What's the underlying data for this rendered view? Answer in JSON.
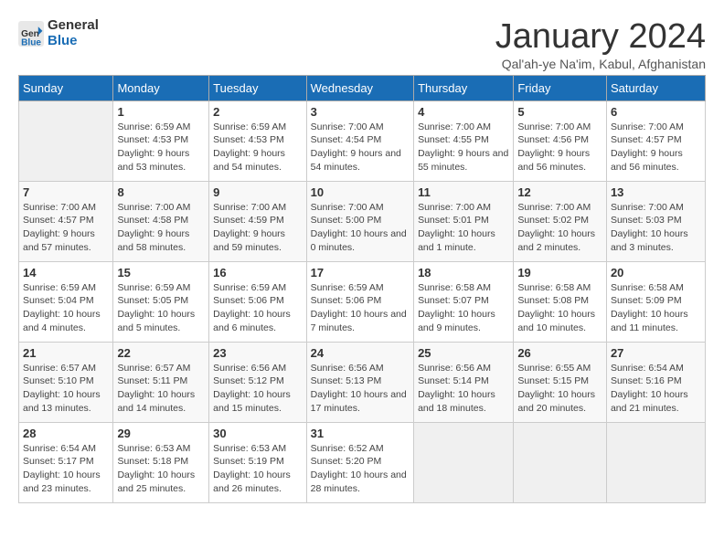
{
  "logo": {
    "line1": "General",
    "line2": "Blue"
  },
  "title": "January 2024",
  "subtitle": "Qal'ah-ye Na'im, Kabul, Afghanistan",
  "days_of_week": [
    "Sunday",
    "Monday",
    "Tuesday",
    "Wednesday",
    "Thursday",
    "Friday",
    "Saturday"
  ],
  "weeks": [
    [
      {
        "day": "",
        "sunrise": "",
        "sunset": "",
        "daylight": ""
      },
      {
        "day": "1",
        "sunrise": "Sunrise: 6:59 AM",
        "sunset": "Sunset: 4:53 PM",
        "daylight": "Daylight: 9 hours and 53 minutes."
      },
      {
        "day": "2",
        "sunrise": "Sunrise: 6:59 AM",
        "sunset": "Sunset: 4:53 PM",
        "daylight": "Daylight: 9 hours and 54 minutes."
      },
      {
        "day": "3",
        "sunrise": "Sunrise: 7:00 AM",
        "sunset": "Sunset: 4:54 PM",
        "daylight": "Daylight: 9 hours and 54 minutes."
      },
      {
        "day": "4",
        "sunrise": "Sunrise: 7:00 AM",
        "sunset": "Sunset: 4:55 PM",
        "daylight": "Daylight: 9 hours and 55 minutes."
      },
      {
        "day": "5",
        "sunrise": "Sunrise: 7:00 AM",
        "sunset": "Sunset: 4:56 PM",
        "daylight": "Daylight: 9 hours and 56 minutes."
      },
      {
        "day": "6",
        "sunrise": "Sunrise: 7:00 AM",
        "sunset": "Sunset: 4:57 PM",
        "daylight": "Daylight: 9 hours and 56 minutes."
      }
    ],
    [
      {
        "day": "7",
        "sunrise": "Sunrise: 7:00 AM",
        "sunset": "Sunset: 4:57 PM",
        "daylight": "Daylight: 9 hours and 57 minutes."
      },
      {
        "day": "8",
        "sunrise": "Sunrise: 7:00 AM",
        "sunset": "Sunset: 4:58 PM",
        "daylight": "Daylight: 9 hours and 58 minutes."
      },
      {
        "day": "9",
        "sunrise": "Sunrise: 7:00 AM",
        "sunset": "Sunset: 4:59 PM",
        "daylight": "Daylight: 9 hours and 59 minutes."
      },
      {
        "day": "10",
        "sunrise": "Sunrise: 7:00 AM",
        "sunset": "Sunset: 5:00 PM",
        "daylight": "Daylight: 10 hours and 0 minutes."
      },
      {
        "day": "11",
        "sunrise": "Sunrise: 7:00 AM",
        "sunset": "Sunset: 5:01 PM",
        "daylight": "Daylight: 10 hours and 1 minute."
      },
      {
        "day": "12",
        "sunrise": "Sunrise: 7:00 AM",
        "sunset": "Sunset: 5:02 PM",
        "daylight": "Daylight: 10 hours and 2 minutes."
      },
      {
        "day": "13",
        "sunrise": "Sunrise: 7:00 AM",
        "sunset": "Sunset: 5:03 PM",
        "daylight": "Daylight: 10 hours and 3 minutes."
      }
    ],
    [
      {
        "day": "14",
        "sunrise": "Sunrise: 6:59 AM",
        "sunset": "Sunset: 5:04 PM",
        "daylight": "Daylight: 10 hours and 4 minutes."
      },
      {
        "day": "15",
        "sunrise": "Sunrise: 6:59 AM",
        "sunset": "Sunset: 5:05 PM",
        "daylight": "Daylight: 10 hours and 5 minutes."
      },
      {
        "day": "16",
        "sunrise": "Sunrise: 6:59 AM",
        "sunset": "Sunset: 5:06 PM",
        "daylight": "Daylight: 10 hours and 6 minutes."
      },
      {
        "day": "17",
        "sunrise": "Sunrise: 6:59 AM",
        "sunset": "Sunset: 5:06 PM",
        "daylight": "Daylight: 10 hours and 7 minutes."
      },
      {
        "day": "18",
        "sunrise": "Sunrise: 6:58 AM",
        "sunset": "Sunset: 5:07 PM",
        "daylight": "Daylight: 10 hours and 9 minutes."
      },
      {
        "day": "19",
        "sunrise": "Sunrise: 6:58 AM",
        "sunset": "Sunset: 5:08 PM",
        "daylight": "Daylight: 10 hours and 10 minutes."
      },
      {
        "day": "20",
        "sunrise": "Sunrise: 6:58 AM",
        "sunset": "Sunset: 5:09 PM",
        "daylight": "Daylight: 10 hours and 11 minutes."
      }
    ],
    [
      {
        "day": "21",
        "sunrise": "Sunrise: 6:57 AM",
        "sunset": "Sunset: 5:10 PM",
        "daylight": "Daylight: 10 hours and 13 minutes."
      },
      {
        "day": "22",
        "sunrise": "Sunrise: 6:57 AM",
        "sunset": "Sunset: 5:11 PM",
        "daylight": "Daylight: 10 hours and 14 minutes."
      },
      {
        "day": "23",
        "sunrise": "Sunrise: 6:56 AM",
        "sunset": "Sunset: 5:12 PM",
        "daylight": "Daylight: 10 hours and 15 minutes."
      },
      {
        "day": "24",
        "sunrise": "Sunrise: 6:56 AM",
        "sunset": "Sunset: 5:13 PM",
        "daylight": "Daylight: 10 hours and 17 minutes."
      },
      {
        "day": "25",
        "sunrise": "Sunrise: 6:56 AM",
        "sunset": "Sunset: 5:14 PM",
        "daylight": "Daylight: 10 hours and 18 minutes."
      },
      {
        "day": "26",
        "sunrise": "Sunrise: 6:55 AM",
        "sunset": "Sunset: 5:15 PM",
        "daylight": "Daylight: 10 hours and 20 minutes."
      },
      {
        "day": "27",
        "sunrise": "Sunrise: 6:54 AM",
        "sunset": "Sunset: 5:16 PM",
        "daylight": "Daylight: 10 hours and 21 minutes."
      }
    ],
    [
      {
        "day": "28",
        "sunrise": "Sunrise: 6:54 AM",
        "sunset": "Sunset: 5:17 PM",
        "daylight": "Daylight: 10 hours and 23 minutes."
      },
      {
        "day": "29",
        "sunrise": "Sunrise: 6:53 AM",
        "sunset": "Sunset: 5:18 PM",
        "daylight": "Daylight: 10 hours and 25 minutes."
      },
      {
        "day": "30",
        "sunrise": "Sunrise: 6:53 AM",
        "sunset": "Sunset: 5:19 PM",
        "daylight": "Daylight: 10 hours and 26 minutes."
      },
      {
        "day": "31",
        "sunrise": "Sunrise: 6:52 AM",
        "sunset": "Sunset: 5:20 PM",
        "daylight": "Daylight: 10 hours and 28 minutes."
      },
      {
        "day": "",
        "sunrise": "",
        "sunset": "",
        "daylight": ""
      },
      {
        "day": "",
        "sunrise": "",
        "sunset": "",
        "daylight": ""
      },
      {
        "day": "",
        "sunrise": "",
        "sunset": "",
        "daylight": ""
      }
    ]
  ]
}
